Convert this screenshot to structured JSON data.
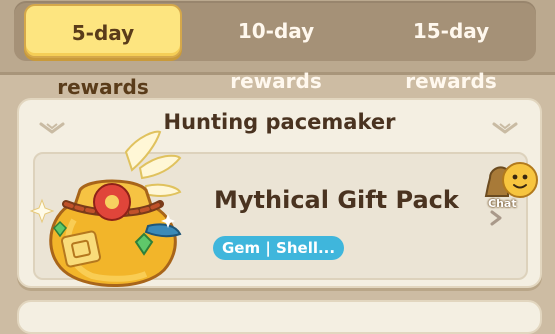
{
  "tabs": [
    {
      "label": "5-day rewards",
      "active": true
    },
    {
      "label": "10-day rewards",
      "active": false
    },
    {
      "label": "15-day rewards",
      "active": false
    }
  ],
  "panel": {
    "title": "Hunting pacemaker",
    "reward": {
      "name": "Mythical Gift Pack",
      "tag": "Gem | Shell...",
      "icon": "gift-pack-icon"
    }
  },
  "chat": {
    "label": "Chat",
    "icon": "chat-bubble-icon"
  },
  "colors": {
    "active_tab": "#fde580",
    "tag": "#3fb6dc",
    "text_dark": "#4a3320"
  }
}
